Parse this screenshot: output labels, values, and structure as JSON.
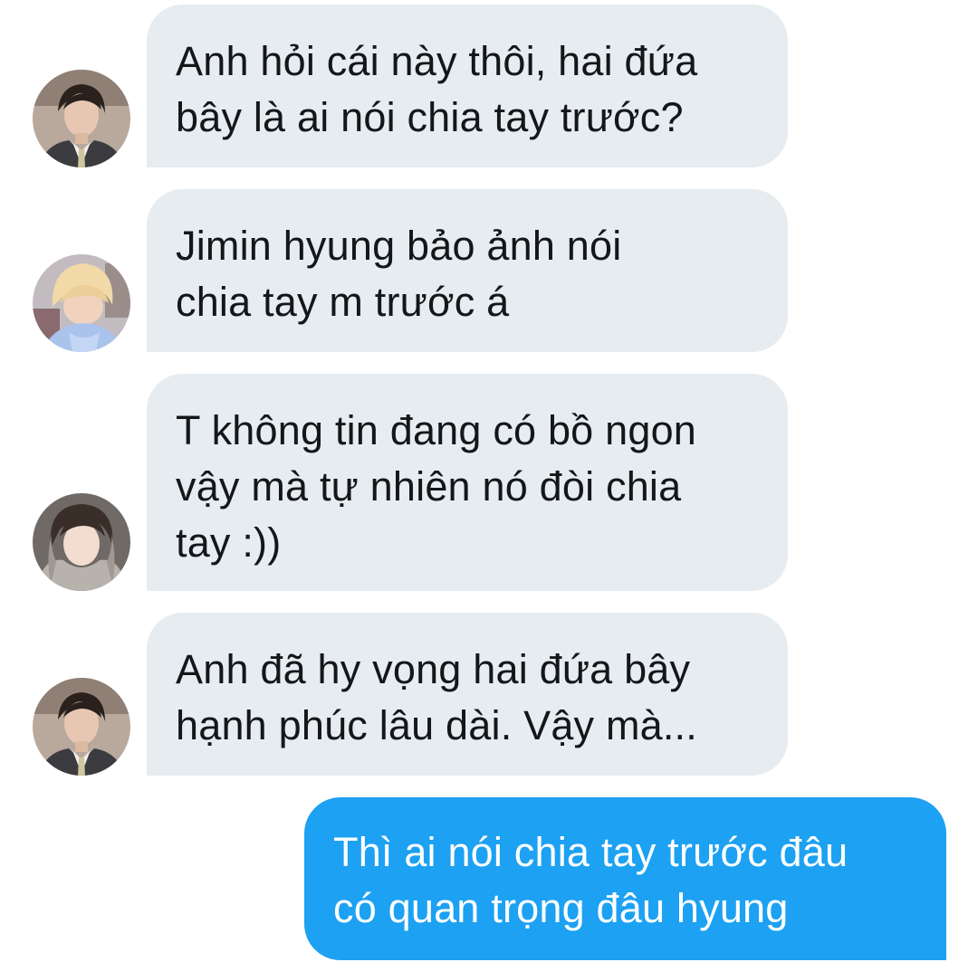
{
  "conversation": {
    "messages": [
      {
        "direction": "incoming",
        "avatar": "avatar-jin-icon",
        "text": "Anh hỏi cái này thôi, hai đứa\nbây là ai nói chia tay trước?"
      },
      {
        "direction": "incoming",
        "avatar": "avatar-jimin-icon",
        "text": "Jimin hyung bảo ảnh nói\nchia tay m trước á"
      },
      {
        "direction": "incoming",
        "avatar": "avatar-taehyung-icon",
        "text": "T không tin đang có bồ ngon\nvậy mà tự nhiên nó đòi chia\ntay :))"
      },
      {
        "direction": "incoming",
        "avatar": "avatar-jin-icon",
        "text": "Anh đã hy vọng hai đứa bây\nhạnh phúc lâu dài. Vậy mà..."
      },
      {
        "direction": "outgoing",
        "text": "Thì ai nói chia tay trước đâu\ncó quan trọng đâu hyung"
      }
    ]
  },
  "colors": {
    "incoming_bubble": "#e6ecf0",
    "incoming_text": "#14171a",
    "outgoing_bubble": "#1da1f2",
    "outgoing_text": "#ffffff"
  }
}
